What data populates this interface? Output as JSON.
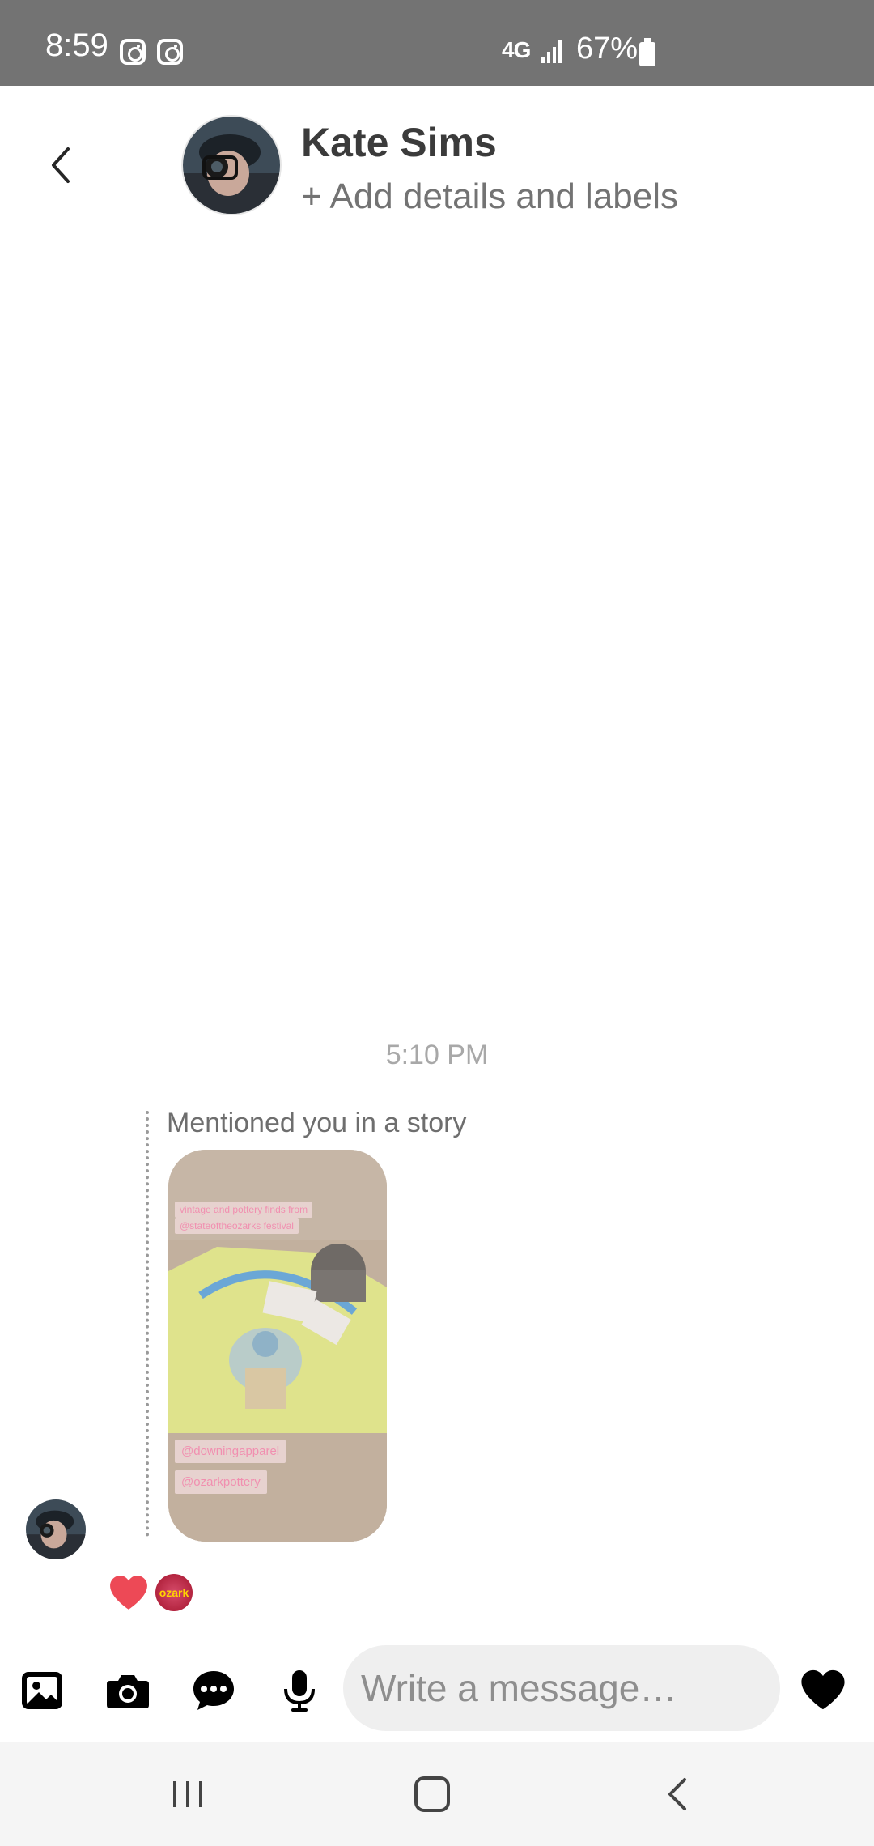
{
  "status_bar": {
    "time": "8:59",
    "network": "4G",
    "battery": "67%",
    "app_icons": [
      "instagram-icon",
      "instagram-icon"
    ]
  },
  "header": {
    "name": "Kate Sims",
    "details": "+ Add details and labels"
  },
  "conversation": {
    "timestamp": "5:10 PM",
    "story": {
      "caption": "Mentioned you in a story",
      "tags": [
        "vintage and pottery finds from",
        "@stateoftheozarks festival",
        "@downingapparel",
        "@ozarkpottery"
      ]
    },
    "reactions": [
      "heart-icon",
      "sticker-icon"
    ],
    "sticker_text": "ozark"
  },
  "composer": {
    "placeholder": "Write a message…",
    "icons": [
      "gallery-icon",
      "camera-icon",
      "chat-icon",
      "microphone-icon",
      "heart-icon"
    ]
  },
  "colors": {
    "status_bar": "#737373",
    "reaction_heart": "#ed4956",
    "input_bg": "#efefef"
  }
}
